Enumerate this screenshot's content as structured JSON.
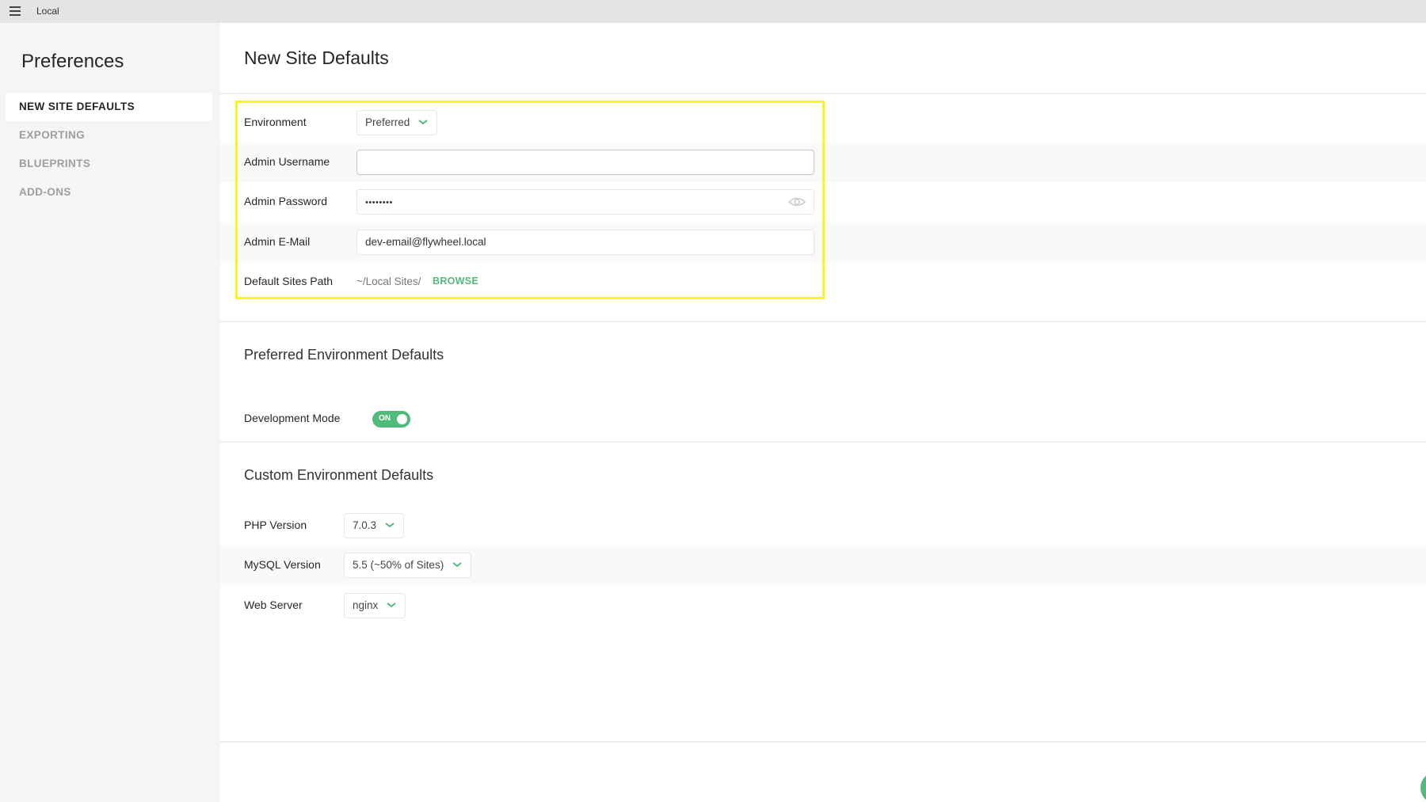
{
  "titlebar": {
    "app_title": "Local",
    "menu_icon": "hamburger-icon"
  },
  "sidebar": {
    "title": "Preferences",
    "items": [
      {
        "label": "NEW SITE DEFAULTS",
        "active": true
      },
      {
        "label": "EXPORTING",
        "active": false
      },
      {
        "label": "BLUEPRINTS",
        "active": false
      },
      {
        "label": "ADD-ONS",
        "active": false
      }
    ]
  },
  "main": {
    "title": "New Site Defaults",
    "fields": {
      "environment": {
        "label": "Environment",
        "value": "Preferred"
      },
      "admin_username": {
        "label": "Admin Username",
        "value": ""
      },
      "admin_password": {
        "label": "Admin Password",
        "value": "••••••••",
        "reveal_icon": "eye-icon"
      },
      "admin_email": {
        "label": "Admin E-Mail",
        "value": "dev-email@flywheel.local"
      },
      "default_sites_path": {
        "label": "Default Sites Path",
        "value": "~/Local Sites/",
        "browse_label": "BROWSE"
      }
    },
    "preferred_section": {
      "title": "Preferred Environment Defaults",
      "development_mode": {
        "label": "Development Mode",
        "state": "ON",
        "enabled": true
      }
    },
    "custom_section": {
      "title": "Custom Environment Defaults",
      "php_version": {
        "label": "PHP Version",
        "value": "7.0.3"
      },
      "mysql_version": {
        "label": "MySQL Version",
        "value": "5.5 (~50% of Sites)"
      },
      "web_server": {
        "label": "Web Server",
        "value": "nginx"
      }
    }
  },
  "colors": {
    "accent_green": "#51bb7b",
    "highlight_yellow": "#f7f71a",
    "sidebar_bg": "#f5f5f5",
    "titlebar_bg": "#e4e4e4"
  }
}
